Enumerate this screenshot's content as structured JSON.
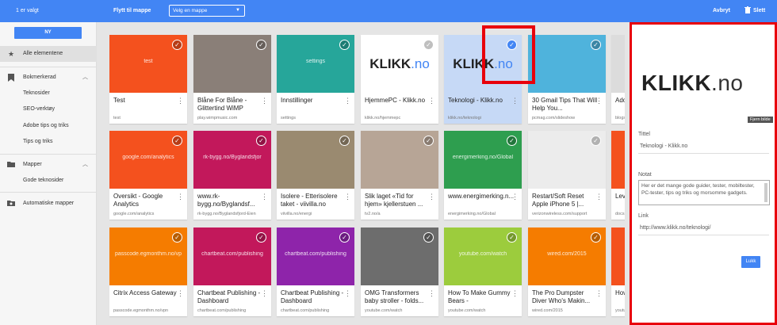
{
  "topbar": {
    "selected_count": "1 er valgt",
    "move_label": "Flytt til mappe",
    "folder_select": "Velg en mappe",
    "cancel": "Avbryt",
    "delete": "Slett"
  },
  "sidebar": {
    "new_button": "NY",
    "items": [
      {
        "label": "Alle elementene",
        "icon": "star-icon"
      },
      {
        "label": "Bokmerkerad",
        "icon": "bookmark-icon"
      },
      {
        "label": "Teknosider"
      },
      {
        "label": "SEO-verktøy"
      },
      {
        "label": "Adobe tips og triks"
      },
      {
        "label": "Tips og triks"
      },
      {
        "label": "Mapper",
        "icon": "folder-icon"
      },
      {
        "label": "Gode teknosider"
      },
      {
        "label": "Automatiske mapper",
        "icon": "auto-folder-icon"
      }
    ]
  },
  "cards": [
    {
      "title": "Test",
      "url": "test",
      "thumb_text": "test",
      "color": "#f4511e"
    },
    {
      "title": "Blåne For Blåne - Glittertind WiMP",
      "url": "play.wimpmusic.com",
      "thumb_text": "",
      "color": "#8a7f78"
    },
    {
      "title": "Innstillinger",
      "url": "settings",
      "thumb_text": "settings",
      "color": "#26a69a"
    },
    {
      "title": "HjemmePC - Klikk.no",
      "url": "klikk.no/hjemmepc",
      "thumb_text": "",
      "color": "#ffffff"
    },
    {
      "title": "Teknologi - Klikk.no",
      "url": "klikk.no/teknologi",
      "thumb_text": "",
      "color": "#c6d9f6"
    },
    {
      "title": "30 Gmail Tips That Will Help You...",
      "url": "pcmag.com/slideshow",
      "thumb_text": "",
      "color": "#4fb3dc"
    },
    {
      "title": "Adob Light",
      "url": "blogs.a",
      "thumb_text": "",
      "color": "#dcdcdc"
    },
    {
      "title": "Oversikt - Google Analytics",
      "url": "google.com/analytics",
      "thumb_text": "google.com/analytics",
      "color": "#f4511e"
    },
    {
      "title": "www.rk-bygg.no/Byglandsf...",
      "url": "rk-bygg.no/Byglandsfjord-Eien",
      "thumb_text": "rk-bygg.no/Byglandsfjor",
      "color": "#c2185b"
    },
    {
      "title": "Isolere - Etterisolere taket - viivilla.no",
      "url": "viivilla.no/energi",
      "thumb_text": "",
      "color": "#9a8a70"
    },
    {
      "title": "Slik laget «Tid for hjem» kjellerstuen ...",
      "url": "tv2.no/a",
      "thumb_text": "",
      "color": "#b7a596"
    },
    {
      "title": "www.energimerking.n...",
      "url": "energimerking.no/Global",
      "thumb_text": "energimerking.no/Global",
      "color": "#2e9e4f"
    },
    {
      "title": "Restart/Soft Reset Apple iPhone 5 |...",
      "url": "verizonwireless.com/support",
      "thumb_text": "",
      "color": "#ececec"
    },
    {
      "title": "Leve sake",
      "url": "docs.g",
      "thumb_text": "",
      "color": "#f4511e"
    },
    {
      "title": "Citrix Access Gateway",
      "url": "passcode.egmonthm.no/vpn",
      "thumb_text": "passcode.egmonthm.no/vp",
      "color": "#f57c00"
    },
    {
      "title": "Chartbeat Publishing - Dashboard",
      "url": "chartbeat.com/publishing",
      "thumb_text": "chartbeat.com/publishing",
      "color": "#c2185b"
    },
    {
      "title": "Chartbeat Publishing - Dashboard",
      "url": "chartbeat.com/publishing",
      "thumb_text": "chartbeat.com/publishing",
      "color": "#8e24aa"
    },
    {
      "title": "OMG Transformers baby stroller - folds...",
      "url": "youtube.com/watch",
      "thumb_text": "",
      "color": "#6d6d6d"
    },
    {
      "title": "How To Make Gummy Bears -",
      "url": "youtube.com/watch",
      "thumb_text": "youtube.com/watch",
      "color": "#9ccc3d"
    },
    {
      "title": "The Pro Dumpster Diver Who's Makin...",
      "url": "wired.com/2015",
      "thumb_text": "wired.com/2015",
      "color": "#f57c00"
    },
    {
      "title": "How Rubi",
      "url": "youtu",
      "thumb_text": "",
      "color": "#f4511e"
    }
  ],
  "panel": {
    "logo_main": "KLIKK",
    "logo_suffix": ".no",
    "remove_image": "Fjern bilde",
    "title_label": "Tittel",
    "title_value": "Teknologi - Klikk.no",
    "note_label": "Notat",
    "note_value": "Her er det mange gode guider, tester, mobiltester, PC-tester, tips og triks og morsomme gadgets.",
    "link_label": "Link",
    "link_value": "http://www.klikk.no/teknologi/",
    "save_button": "Lukk"
  },
  "colors": {
    "accent": "#4285f4",
    "highlight": "#e8000b"
  }
}
